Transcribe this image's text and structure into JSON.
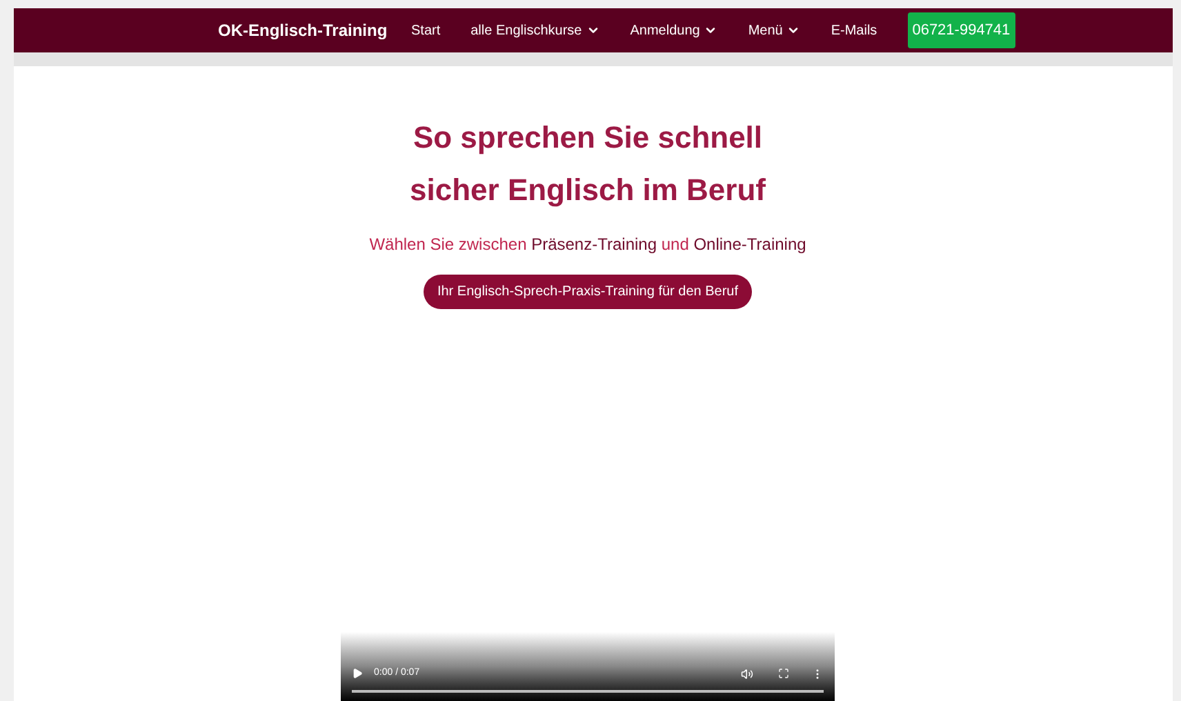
{
  "navbar": {
    "brand": "OK-Englisch-Training",
    "items": [
      {
        "label": "Start",
        "dropdown": false
      },
      {
        "label": "alle Englischkurse",
        "dropdown": true
      },
      {
        "label": "Anmeldung",
        "dropdown": true
      },
      {
        "label": "Menü",
        "dropdown": true
      },
      {
        "label": "E-Mails",
        "dropdown": false
      }
    ],
    "phone_button": "06721-994741"
  },
  "hero": {
    "title_lines": [
      "So sprechen Sie schnell",
      "sicher Englisch im Beruf"
    ],
    "subtitle_parts": [
      {
        "text": "Wählen Sie zwischen ",
        "highlighted": false
      },
      {
        "text": "Präsenz-Training",
        "highlighted": true
      },
      {
        "text": " und ",
        "highlighted": false
      },
      {
        "text": "Online-Training",
        "highlighted": true
      }
    ],
    "cta_button": "Ihr Englisch-Sprech-Praxis-Training für den Beruf"
  },
  "video": {
    "time": "0:00 / 0:07"
  }
}
